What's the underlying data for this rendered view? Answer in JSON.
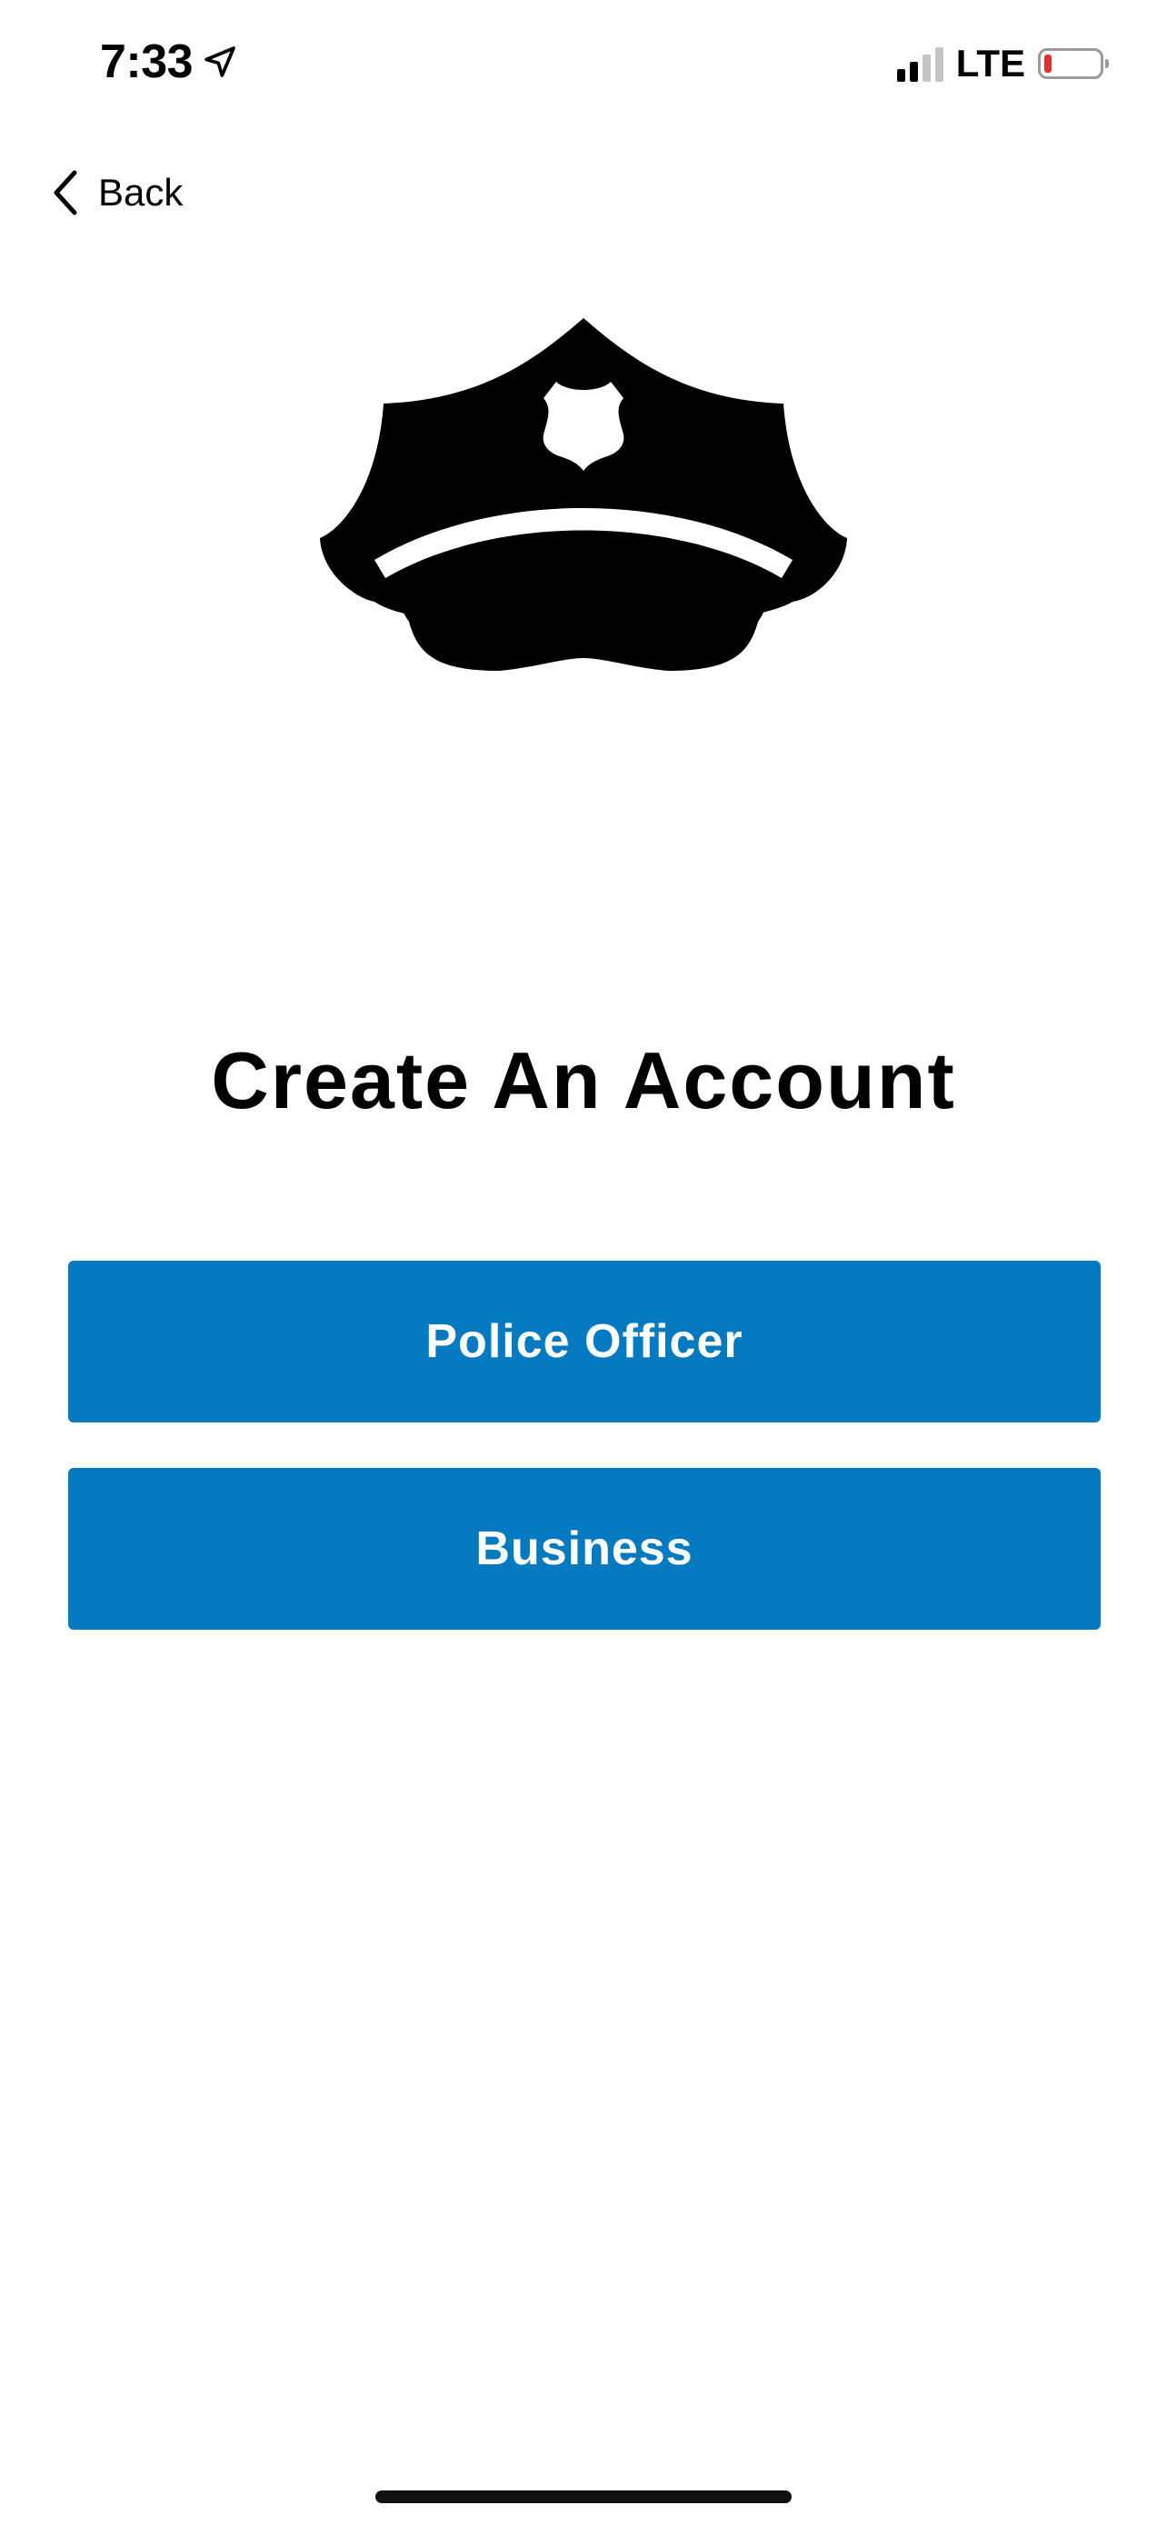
{
  "status_bar": {
    "time": "7:33",
    "network": "LTE",
    "icons": [
      "location-arrow-icon",
      "signal-icon",
      "battery-icon"
    ],
    "battery_color": "#e03131"
  },
  "nav": {
    "back_label": "Back",
    "back_icon": "chevron-left-icon"
  },
  "hero": {
    "icon": "police-hat-icon"
  },
  "title": "Create An Account",
  "buttons": [
    {
      "label": "Police Officer"
    },
    {
      "label": "Business"
    }
  ],
  "colors": {
    "button_bg": "#057ac1",
    "button_text": "#ffffff",
    "background": "#ffffff"
  }
}
